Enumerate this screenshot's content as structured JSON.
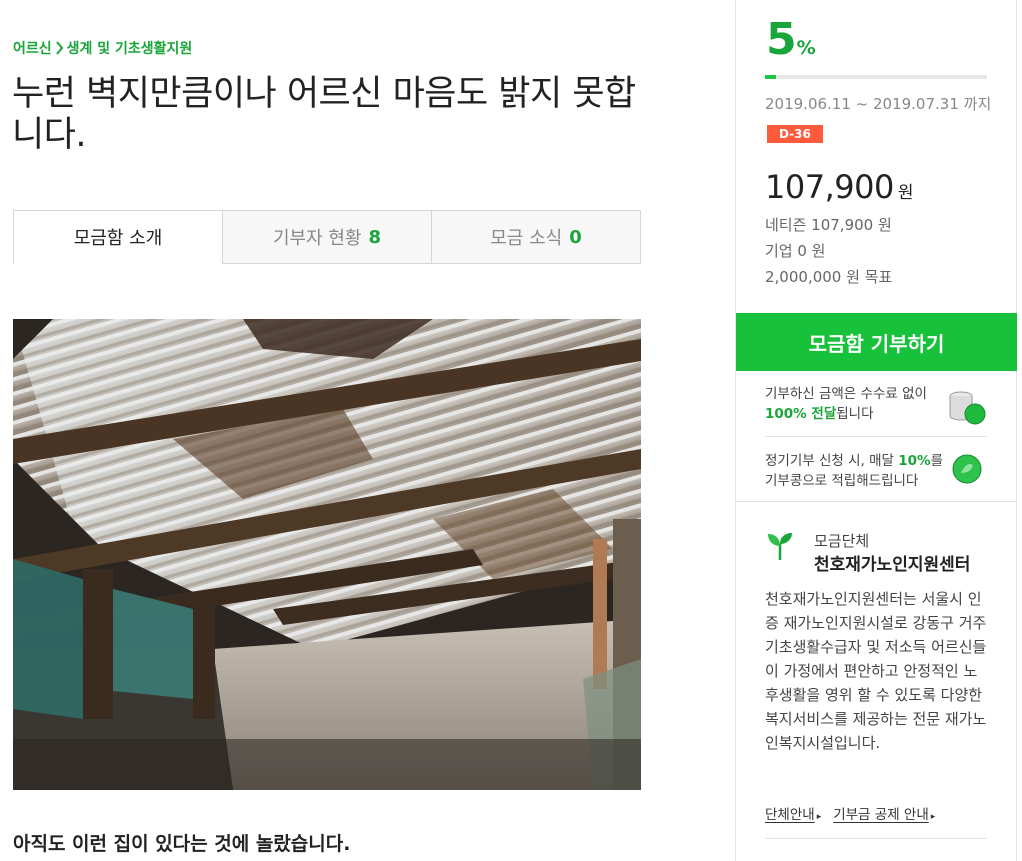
{
  "breadcrumb": {
    "category": "어르신",
    "subcategory": "생계 및 기초생활지원"
  },
  "title": "누런 벽지만큼이나 어르신 마음도 밝지 못합니다.",
  "tabs": [
    {
      "label": "모금함 소개",
      "count": ""
    },
    {
      "label": "기부자 현황",
      "count": "8"
    },
    {
      "label": "모금 소식",
      "count": "0"
    }
  ],
  "article": {
    "subheading": "아직도 이런 집이 있다는 것에 놀랐습니다."
  },
  "campaign": {
    "percent_value": "5",
    "percent_unit": "%",
    "progress": 0.05,
    "period": "2019.06.11 ~ 2019.07.31 까지",
    "dday": "D-36",
    "amount": "107,900",
    "amount_unit": "원",
    "netizen": "네티즌 107,900 원",
    "corporate": "기업 0 원",
    "goal": "2,000,000 원 목표"
  },
  "donate_button": "모금함 기부하기",
  "notes": {
    "fee_a": "기부하신 금액은 수수료 없이",
    "fee_hl": "100% 전달",
    "fee_b": "됩니다",
    "reg_a": "정기기부 신청 시, 매달 ",
    "reg_hl": "10%",
    "reg_b": "를",
    "reg_c": "기부콩으로 적립해드립니다"
  },
  "organization": {
    "label": "모금단체",
    "name": "천호재가노인지원센터",
    "description": "천호재가노인지원센터는 서울시 인증 재가노인지원시설로 강동구 거주 기초생활수급자 및 저소득 어르신들이 가정에서 편안하고 안정적인 노후생활을 영위 할 수 있도록 다양한 복지서비스를 제공하는 전문 재가노인복지시설입니다.",
    "link1": "단체안내",
    "link2": "기부금 공제 안내"
  },
  "colors": {
    "accent": "#1aa53a",
    "button": "#17c23a",
    "dday": "#ff5a3c"
  }
}
